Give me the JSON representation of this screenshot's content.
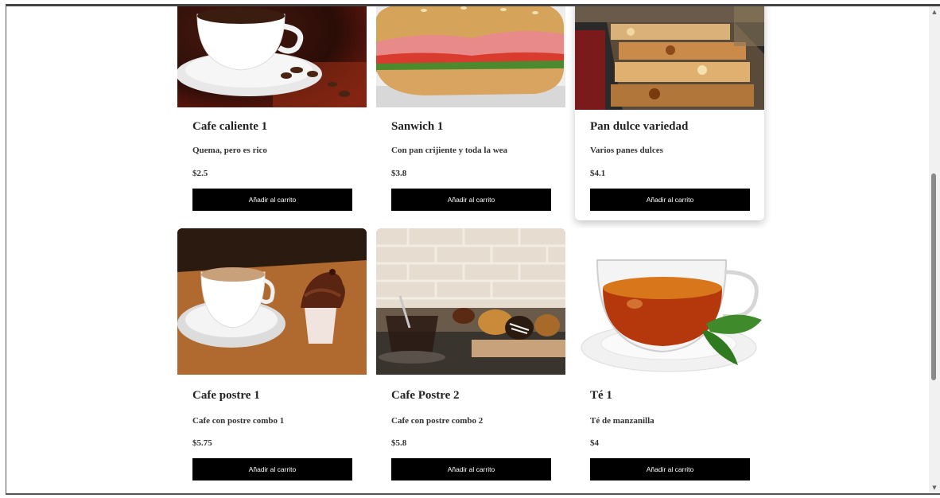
{
  "scrollbar": {
    "up_icon": "triangle-up-icon",
    "down_icon": "triangle-down-icon"
  },
  "products": [
    {
      "name": "Cafe caliente 1",
      "description": "Quema, pero es rico",
      "price": "$2.5",
      "button": "Añadir al carrito",
      "image": "coffee-cup-beans-image"
    },
    {
      "name": "Sanwich 1",
      "description": "Con pan crijiente y toda la wea",
      "price": "$3.8",
      "button": "Añadir al carrito",
      "image": "ham-sandwich-image"
    },
    {
      "name": "Pan dulce variedad",
      "description": "Varios panes dulces",
      "price": "$4.1",
      "button": "Añadir al carrito",
      "image": "bakery-display-case-image"
    },
    {
      "name": "Cafe postre 1",
      "description": "Cafe con postre combo 1",
      "price": "$5.75",
      "button": "Añadir al carrito",
      "image": "coffee-cupcake-image"
    },
    {
      "name": "Cafe Postre 2",
      "description": "Cafe con postre combo 2",
      "price": "$5.8",
      "button": "Añadir al carrito",
      "image": "coffee-pastries-image"
    },
    {
      "name": "Té 1",
      "description": "Té de manzanilla",
      "price": "$4",
      "button": "Añadir al carrito",
      "image": "tea-cup-image"
    }
  ]
}
